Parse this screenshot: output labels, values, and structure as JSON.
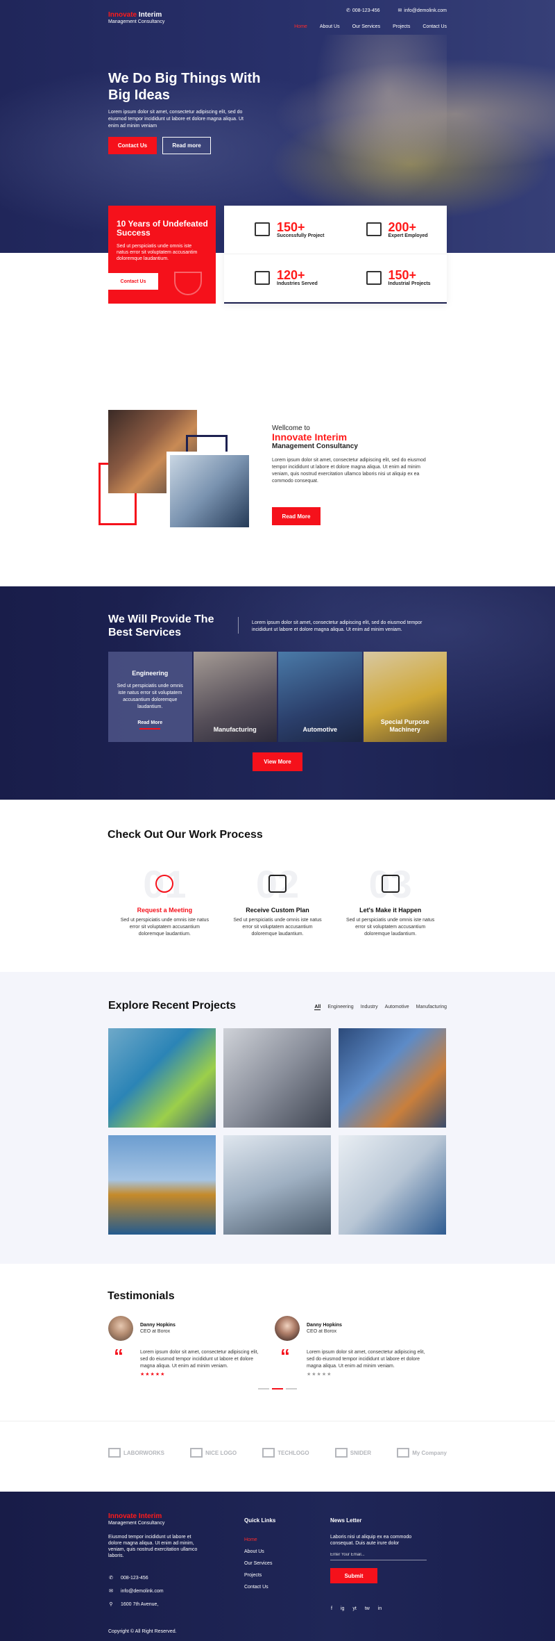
{
  "brand": {
    "name_red": "Innovate",
    "name_white": " Interim",
    "tagline": "Management Consultancy"
  },
  "topbar": {
    "phone_icon": "phone-icon",
    "phone": "008-123-456",
    "mail_icon": "mail-icon",
    "email": "info@demolink.com"
  },
  "nav": {
    "items": [
      "Home",
      "About Us",
      "Our Services",
      "Projects",
      "Contact Us"
    ],
    "active": "Home"
  },
  "hero": {
    "title": "We Do Big Things With Big Ideas",
    "lead": "Lorem ipsum dolor sit amet, consectetur adipiscing elit, sed do eiusmod tempor incididunt ut labore et dolore magna aliqua. Ut enim ad minim veniam",
    "primary_btn": "Contact Us",
    "secondary_btn": "Read more"
  },
  "highlight": {
    "title": "10 Years of Undefeated Success",
    "text": "Sed ut perspiciatis unde omnis iste natus error sit voluptatem accusantim doloremque laudantium.",
    "btn": "Contact Us",
    "icon": "trophy-icon"
  },
  "stats": [
    {
      "value": "150+",
      "label": "Successfully Project",
      "icon": "project-icon"
    },
    {
      "value": "200+",
      "label": "Expert Employed",
      "icon": "team-icon"
    },
    {
      "value": "120+",
      "label": "Industries Served",
      "icon": "factory-icon"
    },
    {
      "value": "150+",
      "label": "Industrial Projects",
      "icon": "industry-icon"
    }
  ],
  "about": {
    "welcome": "Wellcome to",
    "name": "Innovate Interim",
    "sub": "Management Consultancy",
    "text": "Lorem ipsum dolor sit amet, consectetur adipiscing elit, sed do eiusmod tempor incididunt ut labore et dolore magna aliqua. Ut enim ad minim veniam, quis nostrud exercitation ullamco laboris nisi ut aliquip ex ea commodo consequat.",
    "btn": "Read More"
  },
  "services": {
    "title": "We Will Provide The Best Services",
    "intro": "Lorem ipsum dolor sit amet, consectetur adipiscing elit, sed do eiusmod tempor incididunt ut labore et dolore magna aliqua. Ut enim ad minim veniam.",
    "items": [
      {
        "name": "Engineering",
        "text": "Sed ut perspiciatis unde omnis iste natus error sit voluptatem accusantium doloremque laudantium.",
        "link": "Read More"
      },
      {
        "name": "Manufacturing"
      },
      {
        "name": "Automotive"
      },
      {
        "name": "Special Purpose Machinery"
      }
    ],
    "btn": "View More"
  },
  "process": {
    "title": "Check Out Our Work Process",
    "steps": [
      {
        "num": "01",
        "title": "Request a Meeting",
        "text": "Sed ut perspiciatis unde omnis iste natus error sit voluptatem accusantium doloremque laudantium.",
        "icon": "meeting-icon"
      },
      {
        "num": "02",
        "title": "Receive Custom Plan",
        "text": "Sed ut perspiciatis unde omnis iste natus error sit voluptatem accusantium doloremque laudantium.",
        "icon": "plan-icon"
      },
      {
        "num": "03",
        "title": "Let's Make it Happen",
        "text": "Sed ut perspiciatis unde omnis iste natus error sit voluptatem accusantium doloremque laudantium.",
        "icon": "building-icon"
      }
    ]
  },
  "projects": {
    "title": "Explore Recent Projects",
    "filters": [
      "All",
      "Engineering",
      "Industry",
      "Automotive",
      "Manufacturing"
    ],
    "active_filter": "All"
  },
  "testimonials": {
    "title": "Testimonials",
    "items": [
      {
        "name": "Danny Hopkins",
        "role": "CEO at Borox",
        "text": "Lorem ipsum dolor sit amet, consectetur adipiscing elit, sed do eiusmod tempor incididunt ut labore et dolore magna aliqua. Ut enim ad minim veniam.",
        "rating": 5
      },
      {
        "name": "Danny Hopkins",
        "role": "CEO at Borox",
        "text": "Lorem ipsum dolor sit amet, consectetur adipiscing elit, sed do eiusmod tempor incididunt ut labore et dolore magna aliqua. Ut enim ad minim veniam.",
        "rating": 0
      }
    ]
  },
  "partners": [
    "LABORWORKS",
    "NICE LOGO",
    "TECHLOGO",
    "SNIDER",
    "My Company"
  ],
  "footer": {
    "desc": "Eiusmod tempor incididunt ut labore et dolore magna aliqua. Ut enim ad minim, veniam, quis nostrud exercitation ullamco laboris.",
    "phone": "008-123-456",
    "email": "info@demolink.com",
    "address": "1600 7th Avenue,",
    "quick_links_title": "Quick Links",
    "quick_links": [
      "Home",
      "About Us",
      "Our Services",
      "Projects",
      "Contact Us"
    ],
    "newsletter_title": "News Letter",
    "newsletter_text": "Laboris nisi ut aliquip ex ea commodo consequat. Duis aute irure dolor",
    "email_placeholder": "Enter Your Email...",
    "submit": "Submit",
    "social": [
      "f",
      "ig",
      "yt",
      "tw",
      "in"
    ],
    "copyright": "Copyright © All Right Reserved."
  },
  "colors": {
    "accent": "#f5111b",
    "navy": "#1d2150"
  }
}
